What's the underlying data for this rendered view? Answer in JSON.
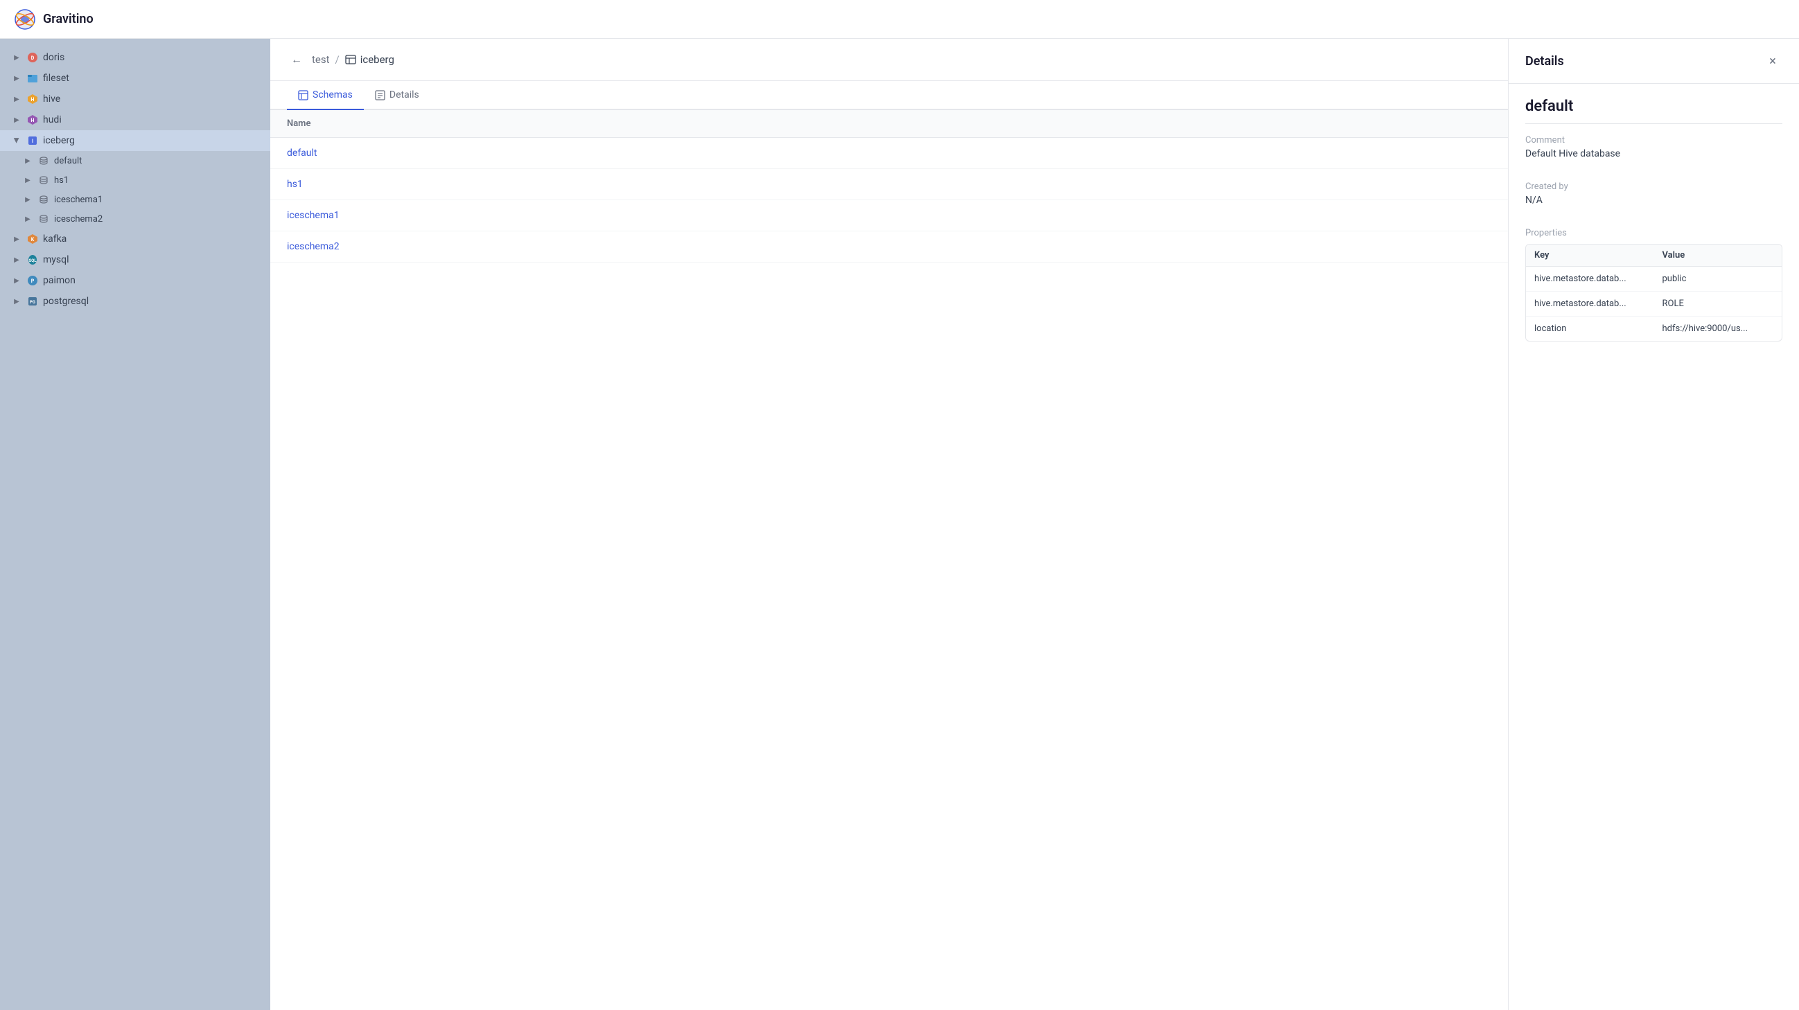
{
  "app": {
    "name": "Gravitino"
  },
  "header": {
    "title": "Gravitino"
  },
  "sidebar": {
    "items": [
      {
        "id": "doris",
        "label": "doris",
        "icon": "doris",
        "expanded": false
      },
      {
        "id": "fileset",
        "label": "fileset",
        "icon": "fileset",
        "expanded": false
      },
      {
        "id": "hive",
        "label": "hive",
        "icon": "hive",
        "expanded": false
      },
      {
        "id": "hudi",
        "label": "hudi",
        "icon": "hudi",
        "expanded": false
      },
      {
        "id": "iceberg",
        "label": "iceberg",
        "icon": "iceberg",
        "expanded": true,
        "children": [
          {
            "id": "default",
            "label": "default",
            "icon": "db"
          },
          {
            "id": "hs1",
            "label": "hs1",
            "icon": "db"
          },
          {
            "id": "iceschema1",
            "label": "iceschema1",
            "icon": "db"
          },
          {
            "id": "iceschema2",
            "label": "iceschema2",
            "icon": "db"
          }
        ]
      },
      {
        "id": "kafka",
        "label": "kafka",
        "icon": "kafka",
        "expanded": false
      },
      {
        "id": "mysql",
        "label": "mysql",
        "icon": "mysql",
        "expanded": false
      },
      {
        "id": "paimon",
        "label": "paimon",
        "icon": "paimon",
        "expanded": false
      },
      {
        "id": "postgresql",
        "label": "postgresql",
        "icon": "postgresql",
        "expanded": false
      }
    ]
  },
  "breadcrumb": {
    "back_label": "←",
    "parent": "test",
    "separator": "/",
    "current": "iceberg"
  },
  "tabs": [
    {
      "id": "schemas",
      "label": "Schemas",
      "active": true
    },
    {
      "id": "details",
      "label": "Details",
      "active": false
    }
  ],
  "table": {
    "header": "Name",
    "rows": [
      {
        "name": "default"
      },
      {
        "name": "hs1"
      },
      {
        "name": "iceschema1"
      },
      {
        "name": "iceschema2"
      }
    ]
  },
  "details_panel": {
    "title": "Details",
    "close_label": "×",
    "name": "default",
    "comment_label": "Comment",
    "comment_value": "Default Hive database",
    "created_by_label": "Created by",
    "created_by_value": "N/A",
    "properties_label": "Properties",
    "properties_table": {
      "key_header": "Key",
      "value_header": "Value",
      "rows": [
        {
          "key": "hive.metastore.datab...",
          "value": "public"
        },
        {
          "key": "hive.metastore.datab...",
          "value": "ROLE"
        },
        {
          "key": "location",
          "value": "hdfs://hive:9000/us..."
        }
      ]
    }
  }
}
